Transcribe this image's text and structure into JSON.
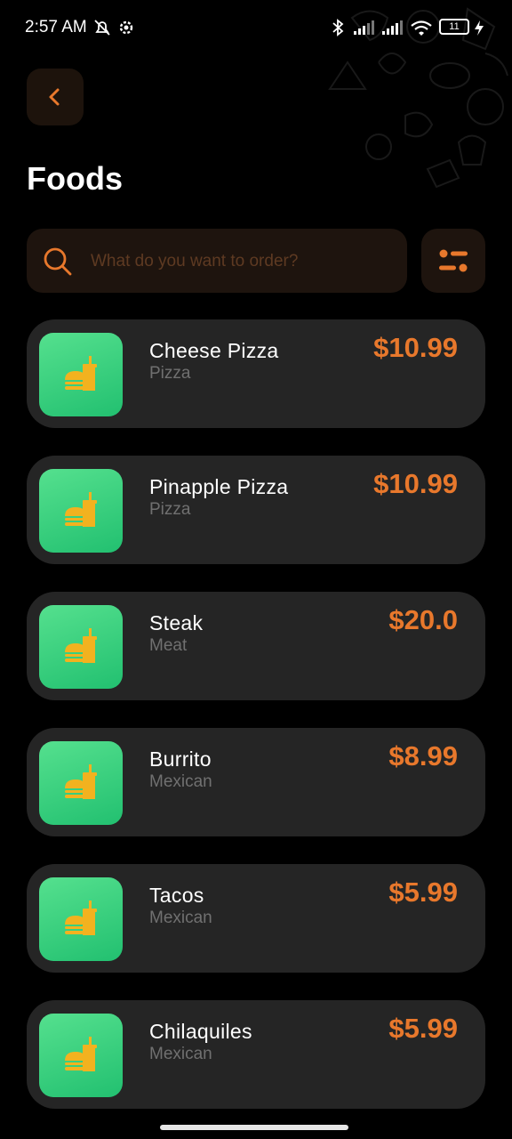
{
  "status_bar": {
    "time": "2:57 AM",
    "battery": "11"
  },
  "header": {
    "title": "Foods"
  },
  "search": {
    "placeholder": "What do you want to order?"
  },
  "colors": {
    "accent": "#e8782c",
    "card": "#252525",
    "thumb": "#2ccf78"
  },
  "items": [
    {
      "name": "Cheese Pizza",
      "category": "Pizza",
      "price": "$10.99"
    },
    {
      "name": "Pinapple Pizza",
      "category": "Pizza",
      "price": "$10.99"
    },
    {
      "name": "Steak",
      "category": "Meat",
      "price": "$20.0"
    },
    {
      "name": "Burrito",
      "category": "Mexican",
      "price": "$8.99"
    },
    {
      "name": "Tacos",
      "category": "Mexican",
      "price": "$5.99"
    },
    {
      "name": "Chilaquiles",
      "category": "Mexican",
      "price": "$5.99"
    }
  ]
}
